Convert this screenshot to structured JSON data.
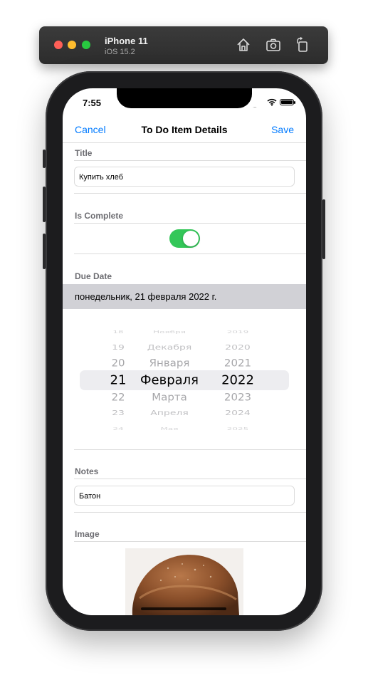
{
  "simulator": {
    "device": "iPhone 11",
    "os": "iOS 15.2",
    "controls": [
      "home-icon",
      "screenshot-icon",
      "rotate-icon"
    ]
  },
  "status_bar": {
    "time": "7:55",
    "signal": "....",
    "battery_level": 1.0
  },
  "nav": {
    "cancel": "Cancel",
    "title": "To Do Item Details",
    "save": "Save"
  },
  "title_section": {
    "label": "Title",
    "value": "Купить хлеб"
  },
  "complete_section": {
    "label": "Is Complete",
    "is_on": true
  },
  "due_date_section": {
    "label": "Due Date",
    "formatted": "понедельник, 21 февраля 2022 г.",
    "picker": {
      "days": [
        "18",
        "19",
        "20",
        "21",
        "22",
        "23",
        "24"
      ],
      "months": [
        "Ноября",
        "Декабря",
        "Января",
        "Февраля",
        "Марта",
        "Апреля",
        "Мая"
      ],
      "years": [
        "2019",
        "2020",
        "2021",
        "2022",
        "2023",
        "2024",
        "2025"
      ],
      "selected_index": 3
    }
  },
  "notes_section": {
    "label": "Notes",
    "value": "Батон"
  },
  "image_section": {
    "label": "Image",
    "image": "bread-loaf-photo"
  },
  "colors": {
    "accent": "#007aff",
    "toggle_on": "#34c759",
    "date_bar": "#d1d1d6",
    "section_label": "#6d6d72"
  }
}
